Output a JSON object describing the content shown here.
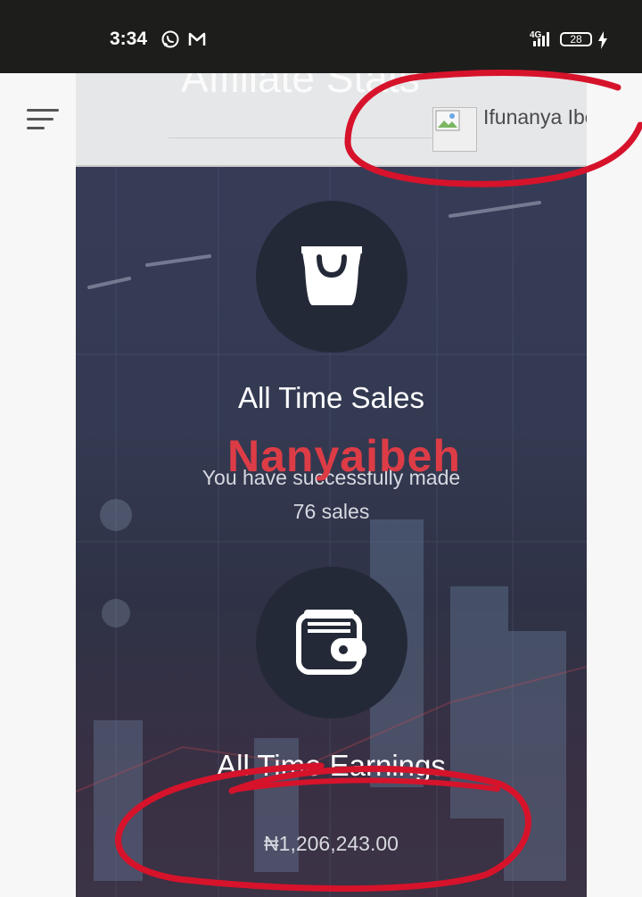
{
  "status_bar": {
    "time": "3:34",
    "network": "4G",
    "battery": "28",
    "app_icons": [
      "whatsapp-icon",
      "gmail-icon"
    ]
  },
  "header": {
    "title": "Affiliate Stats",
    "user_name": "Ifunanya Ibeh"
  },
  "sales": {
    "title": "All Time Sales",
    "message": "You have successfully made",
    "count_text": "76 sales"
  },
  "watermark": "Nanyaibeh",
  "earnings": {
    "title": "All Time Earnings",
    "amount": "₦1,206,243.00"
  },
  "colors": {
    "annotation_red": "#d6132b",
    "watermark_red": "#dd3c46",
    "panel_bg": "#343a52",
    "icon_circle": "#242938"
  }
}
